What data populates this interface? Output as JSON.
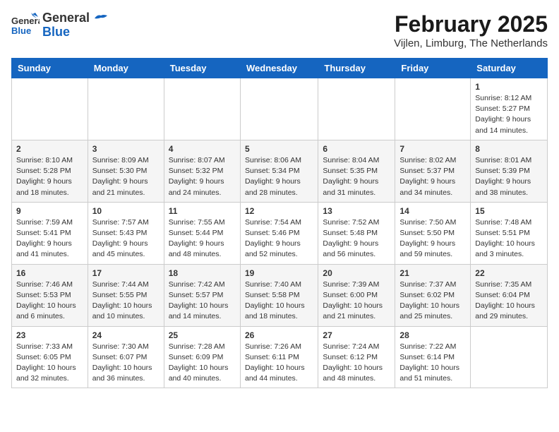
{
  "header": {
    "logo_general": "General",
    "logo_blue": "Blue",
    "month_title": "February 2025",
    "location": "Vijlen, Limburg, The Netherlands"
  },
  "columns": [
    "Sunday",
    "Monday",
    "Tuesday",
    "Wednesday",
    "Thursday",
    "Friday",
    "Saturday"
  ],
  "weeks": [
    [
      {
        "day": "",
        "info": ""
      },
      {
        "day": "",
        "info": ""
      },
      {
        "day": "",
        "info": ""
      },
      {
        "day": "",
        "info": ""
      },
      {
        "day": "",
        "info": ""
      },
      {
        "day": "",
        "info": ""
      },
      {
        "day": "1",
        "info": "Sunrise: 8:12 AM\nSunset: 5:27 PM\nDaylight: 9 hours\nand 14 minutes."
      }
    ],
    [
      {
        "day": "2",
        "info": "Sunrise: 8:10 AM\nSunset: 5:28 PM\nDaylight: 9 hours\nand 18 minutes."
      },
      {
        "day": "3",
        "info": "Sunrise: 8:09 AM\nSunset: 5:30 PM\nDaylight: 9 hours\nand 21 minutes."
      },
      {
        "day": "4",
        "info": "Sunrise: 8:07 AM\nSunset: 5:32 PM\nDaylight: 9 hours\nand 24 minutes."
      },
      {
        "day": "5",
        "info": "Sunrise: 8:06 AM\nSunset: 5:34 PM\nDaylight: 9 hours\nand 28 minutes."
      },
      {
        "day": "6",
        "info": "Sunrise: 8:04 AM\nSunset: 5:35 PM\nDaylight: 9 hours\nand 31 minutes."
      },
      {
        "day": "7",
        "info": "Sunrise: 8:02 AM\nSunset: 5:37 PM\nDaylight: 9 hours\nand 34 minutes."
      },
      {
        "day": "8",
        "info": "Sunrise: 8:01 AM\nSunset: 5:39 PM\nDaylight: 9 hours\nand 38 minutes."
      }
    ],
    [
      {
        "day": "9",
        "info": "Sunrise: 7:59 AM\nSunset: 5:41 PM\nDaylight: 9 hours\nand 41 minutes."
      },
      {
        "day": "10",
        "info": "Sunrise: 7:57 AM\nSunset: 5:43 PM\nDaylight: 9 hours\nand 45 minutes."
      },
      {
        "day": "11",
        "info": "Sunrise: 7:55 AM\nSunset: 5:44 PM\nDaylight: 9 hours\nand 48 minutes."
      },
      {
        "day": "12",
        "info": "Sunrise: 7:54 AM\nSunset: 5:46 PM\nDaylight: 9 hours\nand 52 minutes."
      },
      {
        "day": "13",
        "info": "Sunrise: 7:52 AM\nSunset: 5:48 PM\nDaylight: 9 hours\nand 56 minutes."
      },
      {
        "day": "14",
        "info": "Sunrise: 7:50 AM\nSunset: 5:50 PM\nDaylight: 9 hours\nand 59 minutes."
      },
      {
        "day": "15",
        "info": "Sunrise: 7:48 AM\nSunset: 5:51 PM\nDaylight: 10 hours\nand 3 minutes."
      }
    ],
    [
      {
        "day": "16",
        "info": "Sunrise: 7:46 AM\nSunset: 5:53 PM\nDaylight: 10 hours\nand 6 minutes."
      },
      {
        "day": "17",
        "info": "Sunrise: 7:44 AM\nSunset: 5:55 PM\nDaylight: 10 hours\nand 10 minutes."
      },
      {
        "day": "18",
        "info": "Sunrise: 7:42 AM\nSunset: 5:57 PM\nDaylight: 10 hours\nand 14 minutes."
      },
      {
        "day": "19",
        "info": "Sunrise: 7:40 AM\nSunset: 5:58 PM\nDaylight: 10 hours\nand 18 minutes."
      },
      {
        "day": "20",
        "info": "Sunrise: 7:39 AM\nSunset: 6:00 PM\nDaylight: 10 hours\nand 21 minutes."
      },
      {
        "day": "21",
        "info": "Sunrise: 7:37 AM\nSunset: 6:02 PM\nDaylight: 10 hours\nand 25 minutes."
      },
      {
        "day": "22",
        "info": "Sunrise: 7:35 AM\nSunset: 6:04 PM\nDaylight: 10 hours\nand 29 minutes."
      }
    ],
    [
      {
        "day": "23",
        "info": "Sunrise: 7:33 AM\nSunset: 6:05 PM\nDaylight: 10 hours\nand 32 minutes."
      },
      {
        "day": "24",
        "info": "Sunrise: 7:30 AM\nSunset: 6:07 PM\nDaylight: 10 hours\nand 36 minutes."
      },
      {
        "day": "25",
        "info": "Sunrise: 7:28 AM\nSunset: 6:09 PM\nDaylight: 10 hours\nand 40 minutes."
      },
      {
        "day": "26",
        "info": "Sunrise: 7:26 AM\nSunset: 6:11 PM\nDaylight: 10 hours\nand 44 minutes."
      },
      {
        "day": "27",
        "info": "Sunrise: 7:24 AM\nSunset: 6:12 PM\nDaylight: 10 hours\nand 48 minutes."
      },
      {
        "day": "28",
        "info": "Sunrise: 7:22 AM\nSunset: 6:14 PM\nDaylight: 10 hours\nand 51 minutes."
      },
      {
        "day": "",
        "info": ""
      }
    ]
  ]
}
